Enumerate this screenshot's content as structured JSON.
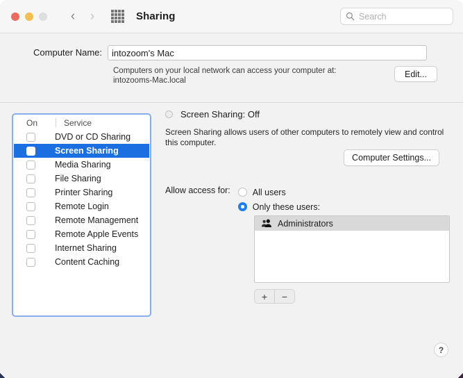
{
  "window": {
    "title": "Sharing",
    "traffic_lights": [
      "close",
      "minimize",
      "zoom"
    ],
    "nav_back": "‹",
    "nav_forward": "›"
  },
  "search": {
    "placeholder": "Search",
    "value": "",
    "icon": "search-icon"
  },
  "computer_name": {
    "label": "Computer Name:",
    "value": "intozoom's Mac",
    "help_line1": "Computers on your local network can access your computer at:",
    "help_line2": "intozooms-Mac.local",
    "edit_button": "Edit..."
  },
  "service_list": {
    "header_on": "On",
    "header_service": "Service",
    "items": [
      {
        "label": "DVD or CD Sharing",
        "checked": false,
        "selected": false
      },
      {
        "label": "Screen Sharing",
        "checked": false,
        "selected": true
      },
      {
        "label": "Media Sharing",
        "checked": false,
        "selected": false
      },
      {
        "label": "File Sharing",
        "checked": false,
        "selected": false
      },
      {
        "label": "Printer Sharing",
        "checked": false,
        "selected": false
      },
      {
        "label": "Remote Login",
        "checked": false,
        "selected": false
      },
      {
        "label": "Remote Management",
        "checked": false,
        "selected": false
      },
      {
        "label": "Remote Apple Events",
        "checked": false,
        "selected": false
      },
      {
        "label": "Internet Sharing",
        "checked": false,
        "selected": false
      },
      {
        "label": "Content Caching",
        "checked": false,
        "selected": false
      }
    ]
  },
  "detail": {
    "status_text": "Screen Sharing: Off",
    "status_indicator": "off",
    "description": "Screen Sharing allows users of other computers to remotely view and control this computer.",
    "computer_settings_button": "Computer Settings...",
    "allow_label": "Allow access for:",
    "radio_all_users": "All users",
    "radio_only_these": "Only these users:",
    "selected_radio": "only_these",
    "users": [
      {
        "name": "Administrators",
        "icon": "group-icon",
        "selected": true
      }
    ],
    "add_button": "+",
    "remove_button": "−"
  },
  "help_button": "?",
  "colors": {
    "accent": "#1b6fe0",
    "radio_accent": "#1b7ef5",
    "focus_ring": "#86aeec",
    "window_bg": "#f2f2f2",
    "titlebar_bg": "#f6f6f6"
  }
}
